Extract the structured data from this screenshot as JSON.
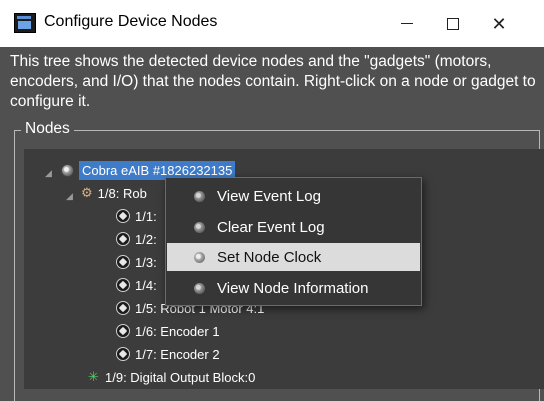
{
  "window": {
    "title": "Configure Device Nodes"
  },
  "description": "This tree shows the detected device nodes and the \"gadgets\" (motors, encoders, and I/O) that the nodes contain. Right-click on a node or gadget to configure it.",
  "nodes_group": {
    "label": "Nodes"
  },
  "tree": {
    "root": {
      "label": "Cobra eAIB #1826232135",
      "icon": "cobra-icon",
      "selected": true
    },
    "robot": {
      "label": "1/8: Rob",
      "icon": "robot-icon"
    },
    "gadgets": [
      {
        "label": "1/1:",
        "icon": "gadget-icon"
      },
      {
        "label": "1/2:",
        "icon": "gadget-icon"
      },
      {
        "label": "1/3:",
        "icon": "gadget-icon"
      },
      {
        "label": "1/4:",
        "icon": "gadget-icon"
      },
      {
        "label": "1/5: Robot 1 Motor 4:1",
        "icon": "gadget-icon"
      },
      {
        "label": "1/6: Encoder 1",
        "icon": "gadget-icon"
      },
      {
        "label": "1/7: Encoder 2",
        "icon": "gadget-icon"
      }
    ],
    "digital": {
      "label": "1/9: Digital Output Block:0",
      "icon": "digital-output-icon"
    }
  },
  "context_menu": {
    "items": [
      {
        "label": "View Event Log",
        "highlighted": false
      },
      {
        "label": "Clear Event Log",
        "highlighted": false
      },
      {
        "label": "Set Node Clock",
        "highlighted": true
      },
      {
        "label": "View Node Information",
        "highlighted": false
      }
    ]
  },
  "colors": {
    "selection": "#3e7bc8",
    "menu_highlight": "#dcdcdc",
    "background": "#505050"
  }
}
